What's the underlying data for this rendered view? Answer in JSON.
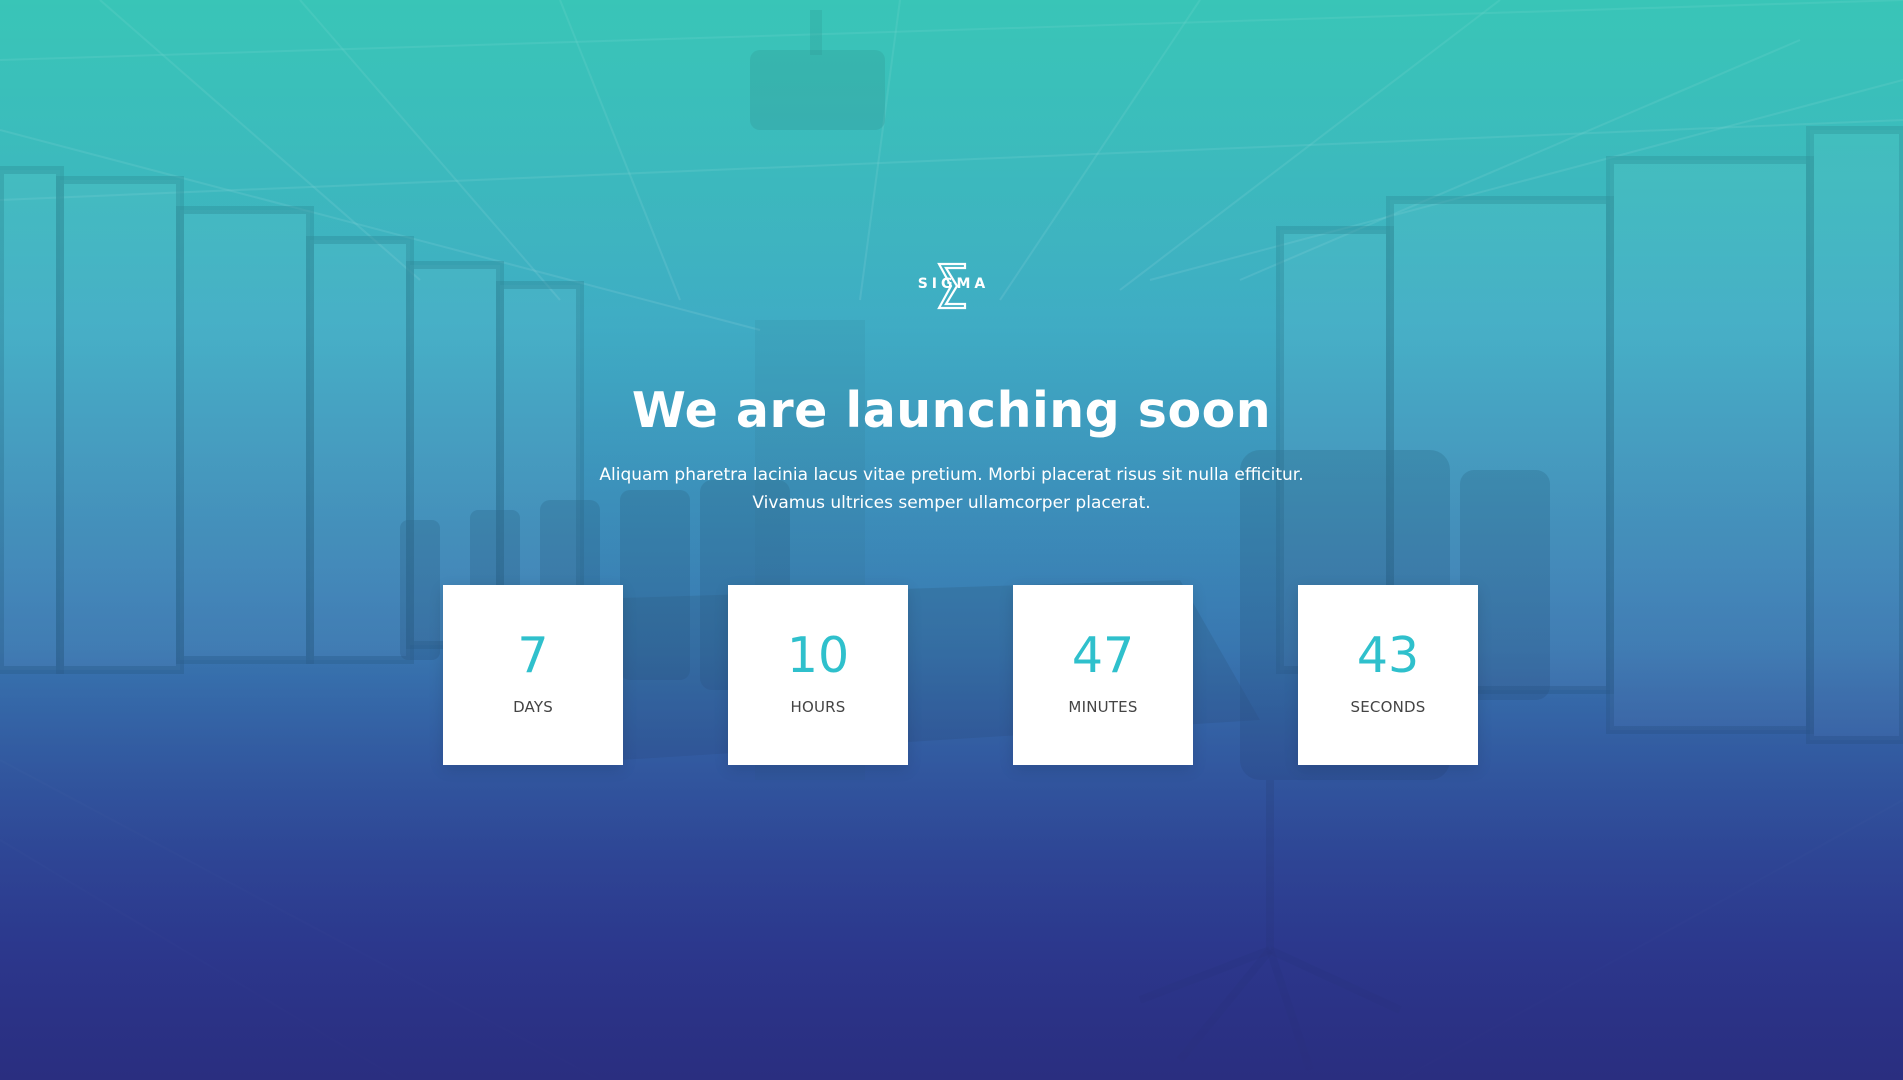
{
  "brand": {
    "logo_text": "SIGMA",
    "logo_icon": "sigma-icon"
  },
  "hero": {
    "title": "We are launching soon",
    "description_line1": "Aliquam pharetra lacinia lacus vitae pretium. Morbi placerat risus sit nulla efficitur.",
    "description_line2": "Vivamus ultrices semper ullamcorper placerat."
  },
  "countdown": {
    "days": {
      "value": "7",
      "label": "DAYS"
    },
    "hours": {
      "value": "10",
      "label": "HOURS"
    },
    "minutes": {
      "value": "47",
      "label": "MINUTES"
    },
    "seconds": {
      "value": "43",
      "label": "SECONDS"
    }
  },
  "colors": {
    "gradient_top": "#3ac4b6",
    "gradient_bottom": "#2a3180",
    "number_accent": "#2fc0cc",
    "box_background": "#ffffff"
  }
}
